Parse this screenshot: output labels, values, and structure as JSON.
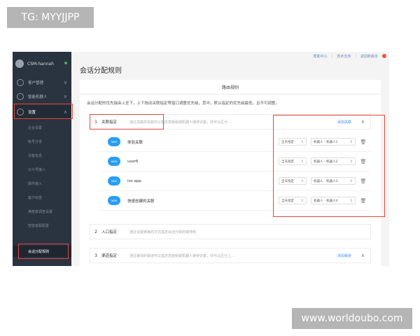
{
  "watermarks": {
    "top": "TG: MYYJJPP",
    "bottom": "www.worldoubo.com"
  },
  "sidebar": {
    "profile_name": "CSM-hannah",
    "nav": [
      {
        "label": "客户管理",
        "chevron": "∨",
        "icon": "users-icon"
      },
      {
        "label": "智能机器人",
        "chevron": "∨",
        "icon": "robot-icon"
      },
      {
        "label": "设置",
        "chevron": "∧",
        "icon": "settings-icon"
      }
    ],
    "sub_items": [
      {
        "label": "企业设置"
      },
      {
        "label": "帐号分享"
      },
      {
        "label": "访客信息"
      },
      {
        "label": "公众号接入"
      },
      {
        "label": "邮件接入"
      },
      {
        "label": "客户标签"
      },
      {
        "label": "满意度调查设置"
      },
      {
        "label": "智能客服配置"
      },
      {
        "label": "会话分配规则"
      }
    ]
  },
  "topbar": {
    "links": [
      "帮助中心",
      "技术支持",
      "返回新版本"
    ]
  },
  "page_title": "会话分配规则",
  "card": {
    "header": "路由规则",
    "description": "会话分配的优先级由上至下，上下拖动关联指定等窗口调整优先级，其中，默认指定的优先级最低，且不可调整。",
    "rules": [
      {
        "num": "1",
        "name": "关联指定",
        "desc": "通过关联的关联可以指定技能组或机器人接待访客，并可以区分...",
        "add": "添加关联",
        "collapse": "∧"
      },
      {
        "num": "2",
        "name": "入口指定",
        "desc": "通过设置链接的方式指定会话分配的接待组",
        "add": "",
        "collapse": ""
      },
      {
        "num": "3",
        "name": "渠道指定",
        "desc": "通过渠道的渠道可以指定技能组或机器人接待访客，并可以区分上...",
        "add": "添加渠道",
        "collapse": "∧"
      }
    ],
    "associations": [
      {
        "tag": "NEW",
        "name": "体验关联",
        "scope": "全天指定",
        "assignee": "机器人 - 机器人1"
      },
      {
        "tag": "NEW",
        "name": "user6",
        "scope": "全天指定",
        "assignee": "机器人 - 机器人2"
      },
      {
        "tag": "NEW",
        "name": "ios app",
        "scope": "全天指定",
        "assignee": "机器人 - 机器人3"
      },
      {
        "tag": "NEW",
        "name": "快速创建的关联",
        "scope": "全天指定",
        "assignee": "机器人 - 机器人4"
      }
    ]
  },
  "colors": {
    "sidebar_bg": "#2a3340",
    "highlight": "#e0483e",
    "accent": "#2a9df4"
  }
}
